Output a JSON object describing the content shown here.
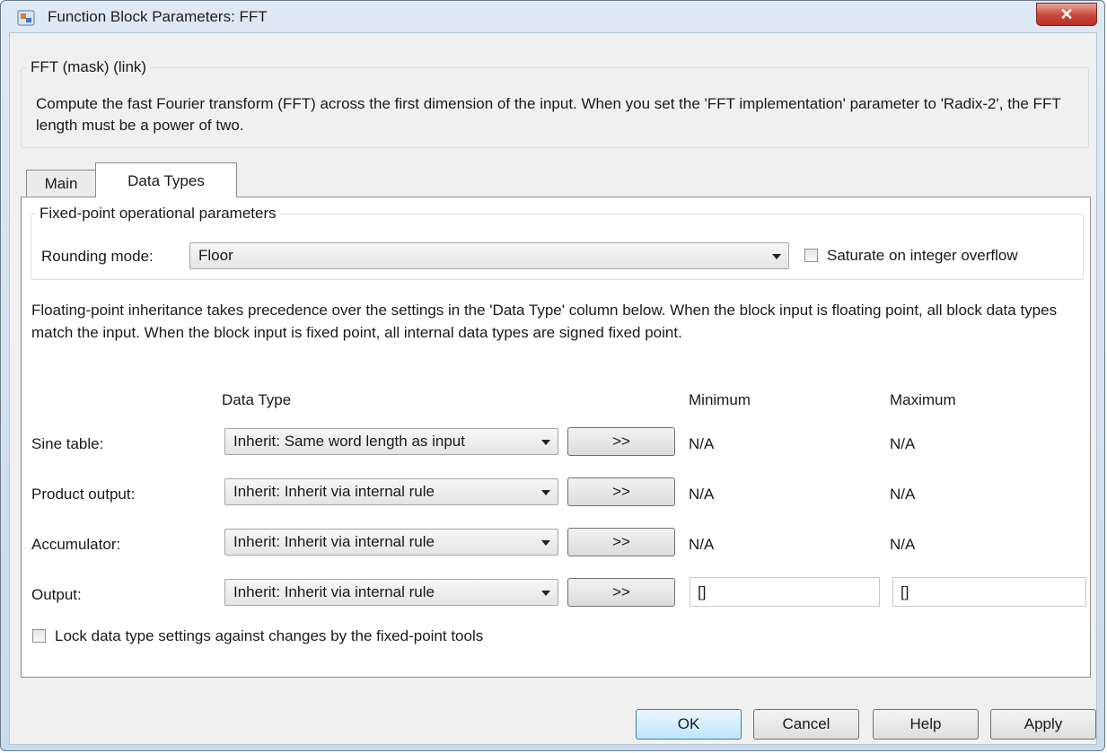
{
  "window": {
    "title": "Function Block Parameters: FFT",
    "close_glyph": "✕"
  },
  "description": {
    "group_title": "FFT (mask) (link)",
    "text": "Compute the fast Fourier transform (FFT) across the first dimension of the input. When you set the 'FFT implementation' parameter to 'Radix-2', the FFT length must be a power of two."
  },
  "tabs": [
    {
      "label": "Main",
      "selected": false
    },
    {
      "label": "Data Types",
      "selected": true
    }
  ],
  "fixed_point": {
    "group_title": "Fixed-point operational parameters",
    "rounding_label": "Rounding mode:",
    "rounding_value": "Floor",
    "saturate_label": "Saturate on integer overflow",
    "saturate_checked": false
  },
  "floating_text": "Floating-point inheritance takes precedence over the settings in the 'Data Type' column below. When the block input is floating point, all block data types match the input. When the block input is fixed point, all internal data types are signed fixed point.",
  "table": {
    "headers": {
      "data_type": "Data Type",
      "minimum": "Minimum",
      "maximum": "Maximum"
    },
    "rows": [
      {
        "label": "Sine table:",
        "data_type": "Inherit: Same word length as input",
        "button": ">>",
        "minimum": "N/A",
        "maximum": "N/A"
      },
      {
        "label": "Product output:",
        "data_type": "Inherit: Inherit via internal rule",
        "button": ">>",
        "minimum": "N/A",
        "maximum": "N/A"
      },
      {
        "label": "Accumulator:",
        "data_type": "Inherit: Inherit via internal rule",
        "button": ">>",
        "minimum": "N/A",
        "maximum": "N/A"
      },
      {
        "label": "Output:",
        "data_type": "Inherit: Inherit via internal rule",
        "button": ">>",
        "minimum": "[]",
        "maximum": "[]"
      }
    ]
  },
  "lock": {
    "label": "Lock data type settings against changes by the fixed-point tools",
    "checked": false
  },
  "buttons": {
    "ok": "OK",
    "cancel": "Cancel",
    "help": "Help",
    "apply": "Apply"
  }
}
